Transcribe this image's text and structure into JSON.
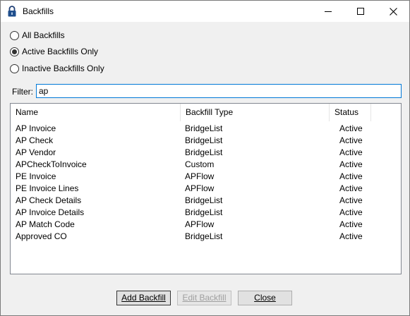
{
  "window": {
    "title": "Backfills"
  },
  "filters": {
    "options": [
      {
        "label": "All Backfills",
        "checked": false
      },
      {
        "label": "Active Backfills Only",
        "checked": true
      },
      {
        "label": "Inactive Backfills Only",
        "checked": false
      }
    ],
    "filter_label": "Filter:",
    "filter_value": "ap"
  },
  "table": {
    "columns": [
      "Name",
      "Backfill Type",
      "Status"
    ],
    "rows": [
      [
        "AP Invoice",
        "BridgeList",
        "Active"
      ],
      [
        "AP Check",
        "BridgeList",
        "Active"
      ],
      [
        "AP Vendor",
        "BridgeList",
        "Active"
      ],
      [
        "APCheckToInvoice",
        "Custom",
        "Active"
      ],
      [
        "PE Invoice",
        "APFlow",
        "Active"
      ],
      [
        "PE Invoice Lines",
        "APFlow",
        "Active"
      ],
      [
        "AP Check Details",
        "BridgeList",
        "Active"
      ],
      [
        "AP Invoice Details",
        "BridgeList",
        "Active"
      ],
      [
        "AP Match Code",
        "APFlow",
        "Active"
      ],
      [
        "Approved CO",
        "BridgeList",
        "Active"
      ]
    ]
  },
  "buttons": {
    "add": "Add Backfill",
    "edit": "Edit Backfill",
    "close": "Close"
  },
  "icons": {
    "app": "lock-icon",
    "minimize": "minimize-icon",
    "maximize": "maximize-icon",
    "close": "close-icon"
  }
}
